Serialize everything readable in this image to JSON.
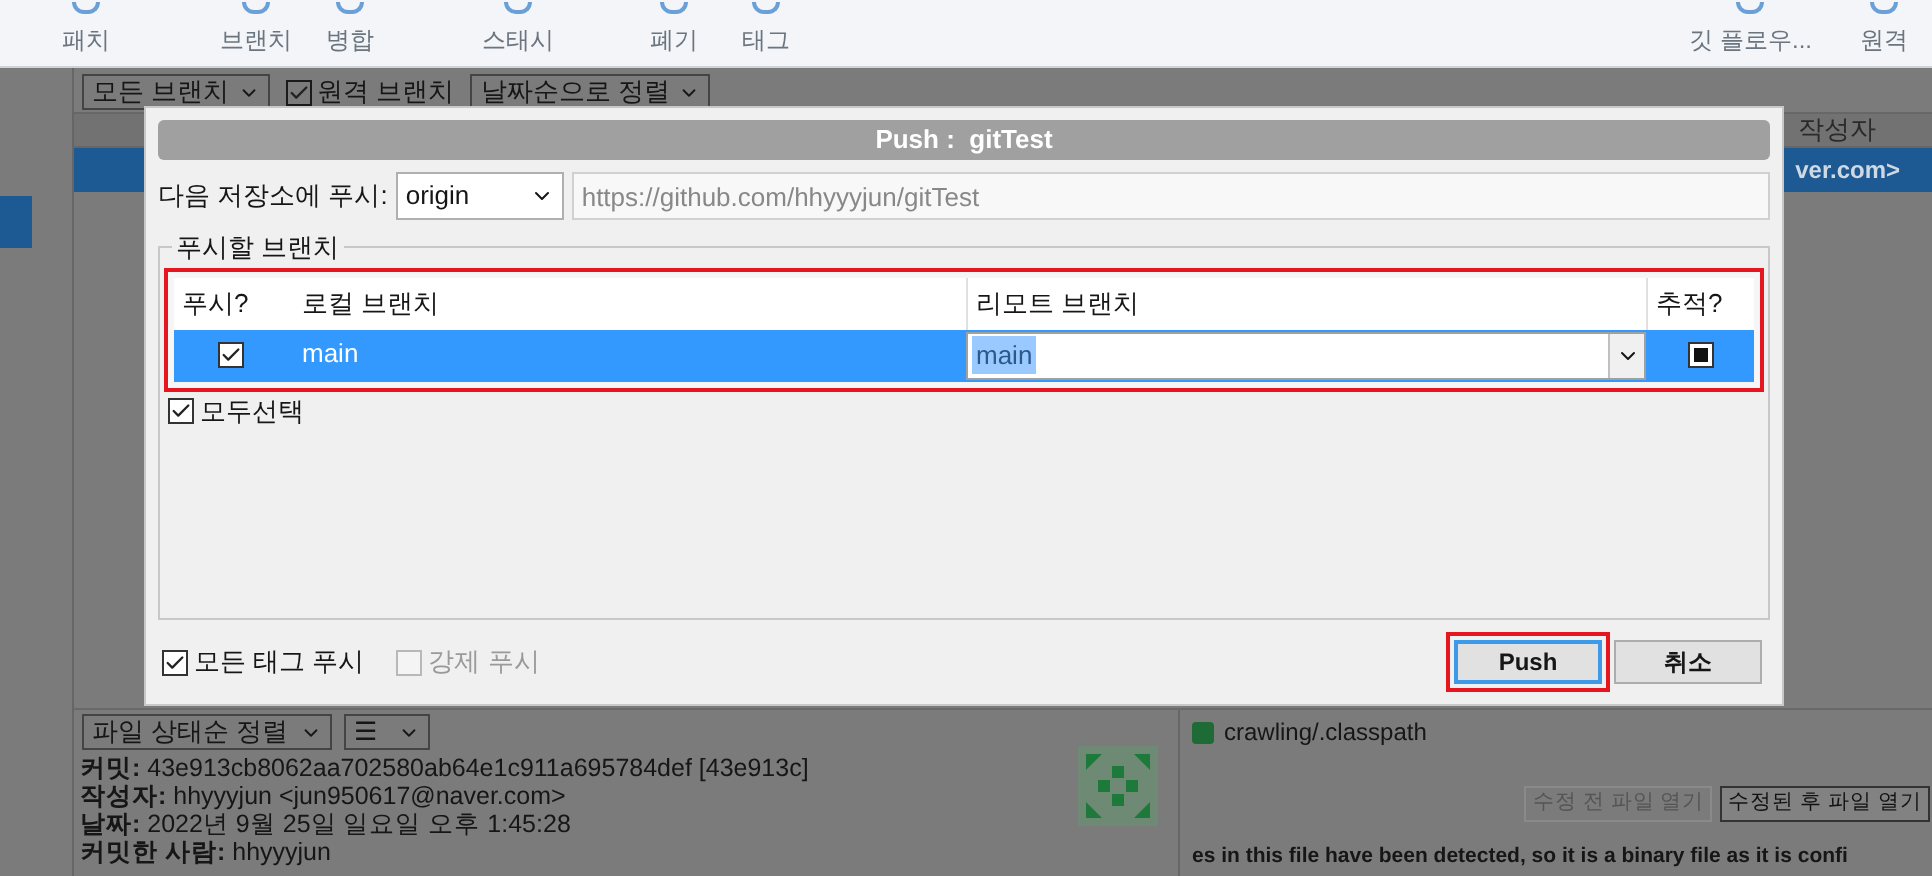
{
  "toolbar": {
    "items": [
      {
        "label": "패치"
      },
      {
        "label": "브랜치"
      },
      {
        "label": "병합"
      },
      {
        "label": "스태시"
      },
      {
        "label": "폐기"
      },
      {
        "label": "태그"
      }
    ],
    "right_items": [
      {
        "label": "깃 플로우..."
      },
      {
        "label": "원격"
      }
    ]
  },
  "filter_bar": {
    "branch_filter": "모든 브랜치",
    "remote_branches": {
      "label": "원격 브랜치",
      "checked": true
    },
    "sort": "날짜순으로 정렬"
  },
  "commit_list": {
    "column_header": "작성자",
    "selected_row": {
      "author": "ver.com>",
      "selected": true
    }
  },
  "file_panel": {
    "sort": "파일 상태순 정렬",
    "view_menu": "☰"
  },
  "commit_details": [
    {
      "label": "커밋:",
      "value": "43e913cb8062aa702580ab64e1c911a695784def [43e913c]"
    },
    {
      "label": "작성자:",
      "value": "hhyyyjun <jun950617@naver.com>"
    },
    {
      "label": "날짜:",
      "value": "2022년 9월 25일 일요일 오후 1:45:28"
    },
    {
      "label": "커밋한 사람:",
      "value": "hhyyyjun"
    }
  ],
  "diff_panel": {
    "file": "crawling/.classpath",
    "buttons": [
      {
        "label": "수정 전 파일 열기",
        "disabled": true
      },
      {
        "label": "수정된 후 파일 열기",
        "disabled": false
      }
    ],
    "message": "es in this file have been detected, so it is a binary file as it is confi"
  },
  "dialog": {
    "title": "Push :  gitTest",
    "repo_label": "다음 저장소에 푸시:",
    "remote": "origin",
    "url": "https://github.com/hhyyyjun/gitTest",
    "group_label": "푸시할 브랜치",
    "columns": [
      "푸시?",
      "로컬 브랜치",
      "리모트 브랜치",
      "추적?"
    ],
    "branches": [
      {
        "push": true,
        "local": "main",
        "remote": "main",
        "tracking": true,
        "selected": true
      }
    ],
    "select_all": {
      "label": "모두선택",
      "checked": true
    },
    "options": [
      {
        "label": "모든 태그 푸시",
        "checked": true,
        "disabled": false
      },
      {
        "label": "강제 푸시",
        "checked": false,
        "disabled": true
      }
    ],
    "buttons": [
      {
        "label": "Push",
        "default": true
      },
      {
        "label": "취소",
        "default": false
      }
    ]
  }
}
